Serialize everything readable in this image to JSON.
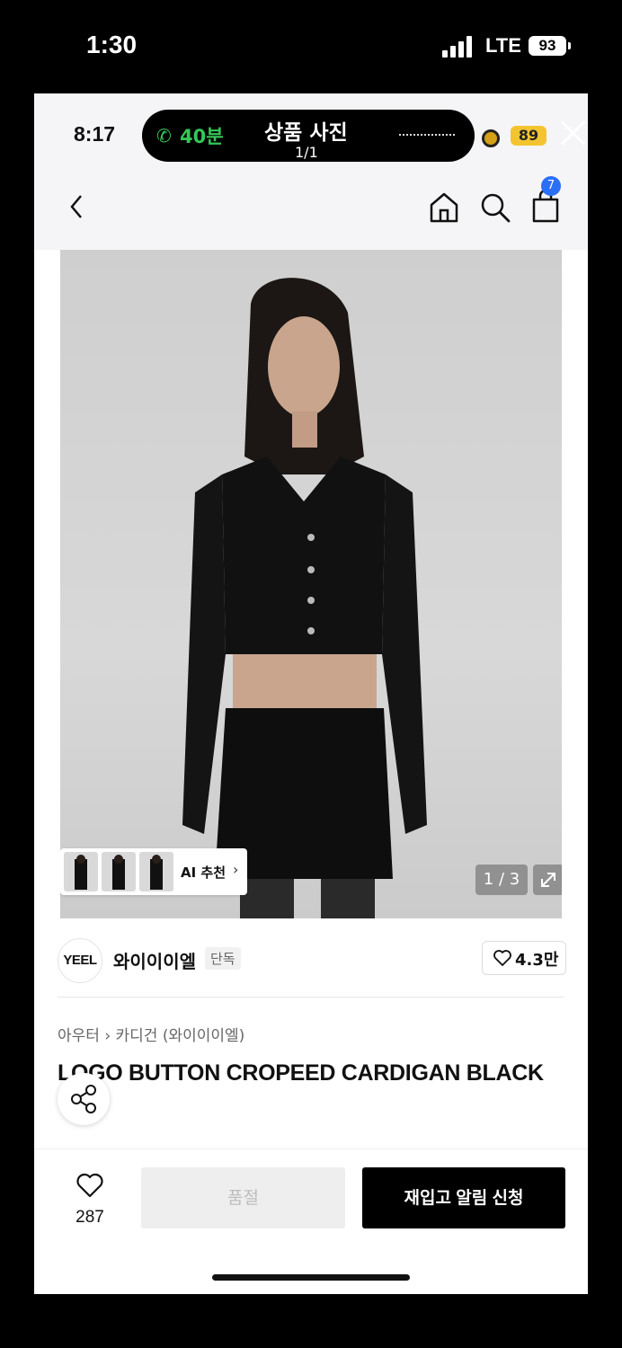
{
  "os_status": {
    "time": "1:30",
    "network": "LTE",
    "battery": "93"
  },
  "inner_status": {
    "time": "8:17",
    "call_duration": "40분",
    "screen_title": "상품 사진",
    "page_indicator": "1/1",
    "coin_count": "89"
  },
  "nav": {
    "cart_count": "7"
  },
  "gallery": {
    "ai_label": "AI 추천",
    "counter": "1 / 3"
  },
  "brand": {
    "logo_text": "YEEL",
    "name": "와이이이엘",
    "tag": "단독",
    "likes": "4.3만"
  },
  "product": {
    "breadcrumb": [
      "아우터",
      "카디건 (와이이이엘)"
    ],
    "title": "LOGO BUTTON CROPEED CARDIGAN BLACK"
  },
  "bottom_bar": {
    "wish_count": "287",
    "soldout_label": "품절",
    "restock_label": "재입고 알림 신청"
  },
  "colors": {
    "accent_badge": "#2b6ff6",
    "call_green": "#35c759",
    "coin_yellow": "#f4c430"
  }
}
